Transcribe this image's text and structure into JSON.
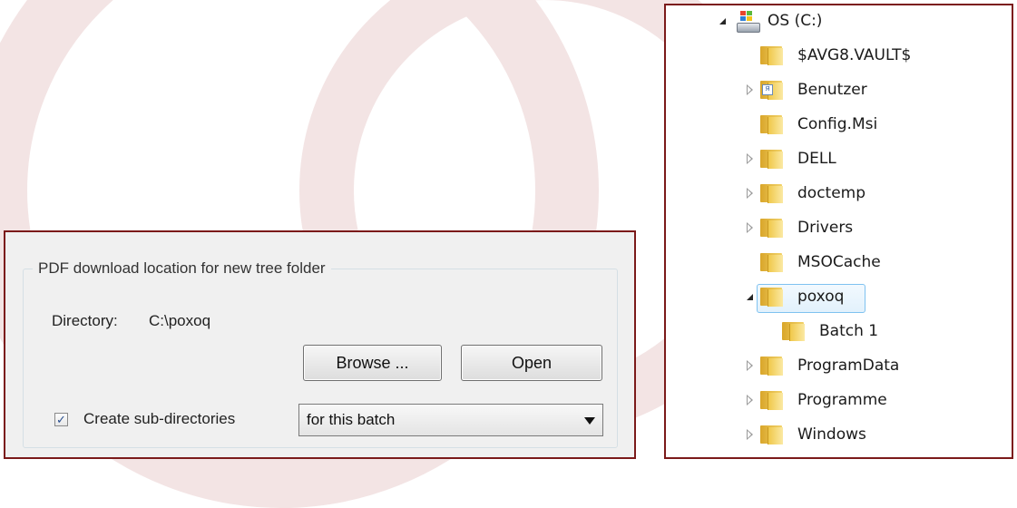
{
  "dialog": {
    "group_title": "PDF download location for new tree folder",
    "directory_label": "Directory:",
    "directory_value": "C:\\poxoq",
    "browse_label": "Browse ...",
    "open_label": "Open",
    "subdir_label": "Create sub-directories",
    "subdir_checked": true,
    "subdir_select_value": "for this batch"
  },
  "tree": {
    "drive": {
      "label": "OS (C:)",
      "expanded": true
    },
    "items": [
      {
        "label": "$AVG8.VAULT$",
        "expander": "none",
        "icon": "folder-icon"
      },
      {
        "label": "Benutzer",
        "expander": "collapsed",
        "icon": "user-folder-icon"
      },
      {
        "label": "Config.Msi",
        "expander": "none",
        "icon": "folder-icon"
      },
      {
        "label": "DELL",
        "expander": "collapsed",
        "icon": "folder-icon"
      },
      {
        "label": "doctemp",
        "expander": "collapsed",
        "icon": "folder-icon"
      },
      {
        "label": "Drivers",
        "expander": "collapsed",
        "icon": "folder-icon"
      },
      {
        "label": "MSOCache",
        "expander": "none",
        "icon": "folder-icon"
      },
      {
        "label": "poxoq",
        "expander": "expanded",
        "icon": "folder-icon",
        "selected": true
      },
      {
        "label": "Batch 1",
        "expander": "none",
        "icon": "folder-icon",
        "child": true
      },
      {
        "label": "ProgramData",
        "expander": "collapsed",
        "icon": "folder-icon"
      },
      {
        "label": "Programme",
        "expander": "collapsed",
        "icon": "folder-icon"
      },
      {
        "label": "Windows",
        "expander": "collapsed",
        "icon": "folder-icon"
      }
    ]
  },
  "colors": {
    "panel_border": "#7b1a1a",
    "selection_border": "#7fc2f0",
    "background_arc": "#f3e4e4"
  }
}
